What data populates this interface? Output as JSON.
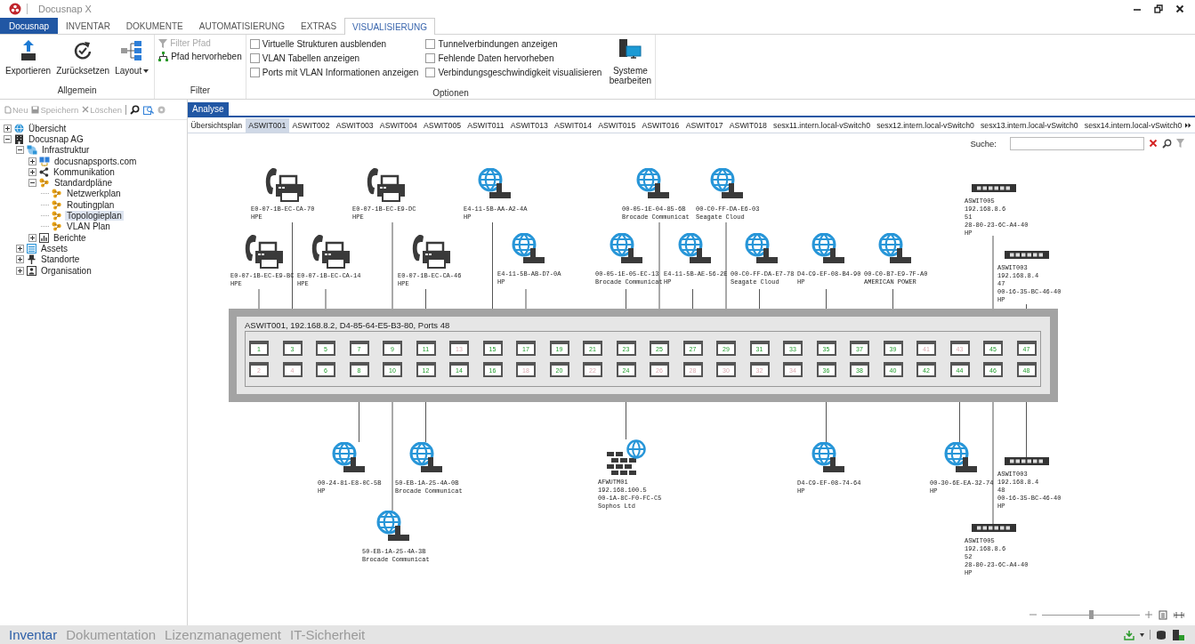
{
  "window": {
    "title": "Docusnap X"
  },
  "ribbon": {
    "tabs": [
      {
        "label": "Docusnap",
        "kind": "app",
        "selected": false
      },
      {
        "label": "INVENTAR",
        "kind": "tab",
        "selected": false
      },
      {
        "label": "DOKUMENTE",
        "kind": "tab",
        "selected": false
      },
      {
        "label": "AUTOMATISIERUNG",
        "kind": "tab",
        "selected": false
      },
      {
        "label": "EXTRAS",
        "kind": "tab",
        "selected": false
      },
      {
        "label": "VISUALISIERUNG",
        "kind": "tab",
        "selected": true
      }
    ],
    "general": {
      "label": "Allgemein",
      "buttons": [
        {
          "label": "Exportieren",
          "kind": "export",
          "dropdown": false
        },
        {
          "label": "Zurücksetzen",
          "kind": "reset",
          "dropdown": false
        },
        {
          "label": "Layout",
          "kind": "layout",
          "dropdown": true
        }
      ]
    },
    "filter": {
      "label": "Filter",
      "buttons": [
        {
          "label": "Filter Pfad",
          "kind": "filter",
          "disabled": true
        },
        {
          "label": "Pfad hervorheben",
          "kind": "path",
          "disabled": false
        }
      ]
    },
    "options": {
      "label": "Optionen",
      "checkboxes": [
        {
          "label": "Virtuelle Strukturen ausblenden",
          "checked": false
        },
        {
          "label": "VLAN Tabellen anzeigen",
          "checked": false
        },
        {
          "label": "Ports mit VLAN Informationen anzeigen",
          "checked": false
        },
        {
          "label": "Tunnelverbindungen anzeigen",
          "checked": false
        },
        {
          "label": "Fehlende Daten hervorheben",
          "checked": false
        },
        {
          "label": "Verbindungsgeschwindigkeit visualisieren",
          "checked": false
        }
      ],
      "button": {
        "label": "Systeme bearbeiten"
      }
    }
  },
  "sidebar": {
    "toolbar": [
      {
        "label": "Neu",
        "kind": "new",
        "disabled": true
      },
      {
        "label": "Speichern",
        "kind": "save",
        "disabled": true
      },
      {
        "label": "Löschen",
        "kind": "delete",
        "disabled": true
      }
    ],
    "tree": [
      {
        "label": "Übersicht",
        "kind": "globe",
        "expanded": false,
        "selected": false
      },
      {
        "label": "Docusnap AG",
        "kind": "building",
        "expanded": true,
        "selected": false,
        "children": [
          {
            "label": "Infrastruktur",
            "kind": "network",
            "expanded": true,
            "selected": false,
            "children": [
              {
                "label": "docusnapsports.com",
                "kind": "domain",
                "expanded": false,
                "selected": false
              },
              {
                "label": "Kommunikation",
                "kind": "share",
                "expanded": false,
                "selected": false
              },
              {
                "label": "Standardpläne",
                "kind": "plan",
                "expanded": true,
                "selected": false,
                "children": [
                  {
                    "label": "Netzwerkplan",
                    "kind": "plan",
                    "selected": false
                  },
                  {
                    "label": "Routingplan",
                    "kind": "plan",
                    "selected": false
                  },
                  {
                    "label": "Topologieplan",
                    "kind": "plan",
                    "selected": true
                  },
                  {
                    "label": "VLAN Plan",
                    "kind": "plan",
                    "selected": false
                  }
                ]
              },
              {
                "label": "Berichte",
                "kind": "report",
                "expanded": false,
                "selected": false
              }
            ]
          },
          {
            "label": "Assets",
            "kind": "assets",
            "expanded": false,
            "selected": false
          },
          {
            "label": "Standorte",
            "kind": "location",
            "expanded": false,
            "selected": false
          },
          {
            "label": "Organisation",
            "kind": "org",
            "expanded": false,
            "selected": false
          }
        ]
      }
    ]
  },
  "doc_tabs": [
    {
      "label": "Analyse",
      "selected": true
    }
  ],
  "view_tabs": [
    {
      "label": "Übersichtsplan",
      "selected": false
    },
    {
      "label": "ASWIT001",
      "selected": true
    },
    {
      "label": "ASWIT002",
      "selected": false
    },
    {
      "label": "ASWIT003",
      "selected": false
    },
    {
      "label": "ASWIT004",
      "selected": false
    },
    {
      "label": "ASWIT005",
      "selected": false
    },
    {
      "label": "ASWIT011",
      "selected": false
    },
    {
      "label": "ASWIT013",
      "selected": false
    },
    {
      "label": "ASWIT014",
      "selected": false
    },
    {
      "label": "ASWIT015",
      "selected": false
    },
    {
      "label": "ASWIT016",
      "selected": false
    },
    {
      "label": "ASWIT017",
      "selected": false
    },
    {
      "label": "ASWIT018",
      "selected": false
    },
    {
      "label": "sesx11.intern.local-vSwitch0",
      "selected": false
    },
    {
      "label": "sesx12.intern.local-vSwitch0",
      "selected": false
    },
    {
      "label": "sesx13.intern.local-vSwitch0",
      "selected": false
    },
    {
      "label": "sesx14.intern.local-vSwitch0",
      "selected": false
    }
  ],
  "search": {
    "label": "Suche:"
  },
  "diagram": {
    "switch": {
      "label": "ASWIT001, 192.168.8.2, D4-85-64-E5-B3-80, Ports 48",
      "ports": [
        {
          "label": "1",
          "active": true
        },
        {
          "label": "2",
          "active": false
        },
        {
          "label": "3",
          "active": true
        },
        {
          "label": "4",
          "active": false
        },
        {
          "label": "5",
          "active": true
        },
        {
          "label": "6",
          "active": true
        },
        {
          "label": "7",
          "active": true
        },
        {
          "label": "8",
          "active": true
        },
        {
          "label": "9",
          "active": true
        },
        {
          "label": "10",
          "active": true
        },
        {
          "label": "11",
          "active": true
        },
        {
          "label": "12",
          "active": true
        },
        {
          "label": "13",
          "active": false
        },
        {
          "label": "14",
          "active": true
        },
        {
          "label": "15",
          "active": true
        },
        {
          "label": "16",
          "active": true
        },
        {
          "label": "17",
          "active": true
        },
        {
          "label": "18",
          "active": false
        },
        {
          "label": "19",
          "active": true
        },
        {
          "label": "20",
          "active": true
        },
        {
          "label": "21",
          "active": true
        },
        {
          "label": "22",
          "active": false
        },
        {
          "label": "23",
          "active": true
        },
        {
          "label": "24",
          "active": true
        },
        {
          "label": "25",
          "active": true
        },
        {
          "label": "26",
          "active": false
        },
        {
          "label": "27",
          "active": true
        },
        {
          "label": "28",
          "active": false
        },
        {
          "label": "29",
          "active": true
        },
        {
          "label": "30",
          "active": false
        },
        {
          "label": "31",
          "active": true
        },
        {
          "label": "32",
          "active": false
        },
        {
          "label": "33",
          "active": true
        },
        {
          "label": "34",
          "active": false
        },
        {
          "label": "35",
          "active": true
        },
        {
          "label": "36",
          "active": true
        },
        {
          "label": "37",
          "active": true
        },
        {
          "label": "38",
          "active": true
        },
        {
          "label": "39",
          "active": true
        },
        {
          "label": "40",
          "active": true
        },
        {
          "label": "41",
          "active": false
        },
        {
          "label": "42",
          "active": true
        },
        {
          "label": "43",
          "active": false
        },
        {
          "label": "44",
          "active": true
        },
        {
          "label": "45",
          "active": true
        },
        {
          "label": "46",
          "active": true
        },
        {
          "label": "47",
          "active": true
        },
        {
          "label": "48",
          "active": true
        }
      ]
    },
    "nodes": [
      {
        "kind": "phone",
        "lines": [
          "E0-07-1B-EC-CA-70",
          "HPE"
        ]
      },
      {
        "kind": "phone",
        "lines": [
          "E0-07-1B-EC-E9-DC",
          "HPE"
        ]
      },
      {
        "kind": "globe",
        "lines": [
          "E4-11-5B-AA-A2-4A",
          "HP"
        ]
      },
      {
        "kind": "globe",
        "lines": [
          "00-05-1E-04-85-6B",
          "Brocade Communicat"
        ]
      },
      {
        "kind": "globe",
        "lines": [
          "00-C0-FF-DA-E6-03",
          "Seagate Cloud"
        ]
      },
      {
        "kind": "switch",
        "lines": [
          "ASWIT005",
          "192.168.8.6",
          "51",
          "28-80-23-6C-A4-40",
          "HP"
        ]
      },
      {
        "kind": "phone",
        "lines": [
          "E0-07-1B-EC-E9-BC",
          "HPE"
        ]
      },
      {
        "kind": "phone",
        "lines": [
          "E0-07-1B-EC-CA-14",
          "HPE"
        ]
      },
      {
        "kind": "phone",
        "lines": [
          "E0-07-1B-EC-CA-46",
          "HPE"
        ]
      },
      {
        "kind": "globe",
        "lines": [
          "E4-11-5B-AB-D7-0A",
          "HP"
        ]
      },
      {
        "kind": "globe",
        "lines": [
          "00-05-1E-05-EC-13",
          "Brocade Communicat"
        ]
      },
      {
        "kind": "globe",
        "lines": [
          "E4-11-5B-AE-56-2E",
          "HP"
        ]
      },
      {
        "kind": "globe",
        "lines": [
          "00-C0-FF-DA-E7-78",
          "Seagate Cloud"
        ]
      },
      {
        "kind": "globe",
        "lines": [
          "D4-C9-EF-08-B4-90",
          "HP"
        ]
      },
      {
        "kind": "globe",
        "lines": [
          "00-C0-B7-E9-7F-A0",
          "AMERICAN POWER"
        ]
      },
      {
        "kind": "switch",
        "lines": [
          "ASWIT003",
          "192.168.8.4",
          "47",
          "00-16-35-BC-46-40",
          "HP"
        ]
      },
      {
        "kind": "globe",
        "lines": [
          "00-24-81-E8-0C-5B",
          "HP"
        ]
      },
      {
        "kind": "globe",
        "lines": [
          "50-EB-1A-25-4A-0B",
          "Brocade Communicat"
        ]
      },
      {
        "kind": "firewall",
        "lines": [
          "AFWUTM01",
          "192.168.100.5",
          "00-1A-8C-F0-FC-C5",
          "Sophos Ltd"
        ]
      },
      {
        "kind": "globe",
        "lines": [
          "D4-C9-EF-08-74-64",
          "HP"
        ]
      },
      {
        "kind": "globe",
        "lines": [
          "00-30-6E-EA-32-74",
          "HP"
        ]
      },
      {
        "kind": "switch",
        "lines": [
          "ASWIT003",
          "192.168.8.4",
          "48",
          "00-16-35-BC-46-40",
          "HP"
        ]
      },
      {
        "kind": "globe",
        "lines": [
          "50-EB-1A-25-4A-3B",
          "Brocade Communicat"
        ]
      },
      {
        "kind": "switch",
        "lines": [
          "ASWIT005",
          "192.168.8.6",
          "52",
          "28-80-23-6C-A4-40",
          "HP"
        ]
      }
    ]
  },
  "zoom": {
    "level": 0.5
  },
  "status_bar": {
    "tabs": [
      {
        "label": "Inventar",
        "selected": true
      },
      {
        "label": "Dokumentation",
        "selected": false
      },
      {
        "label": "Lizenzmanagement",
        "selected": false
      },
      {
        "label": "IT-Sicherheit",
        "selected": false
      }
    ]
  }
}
